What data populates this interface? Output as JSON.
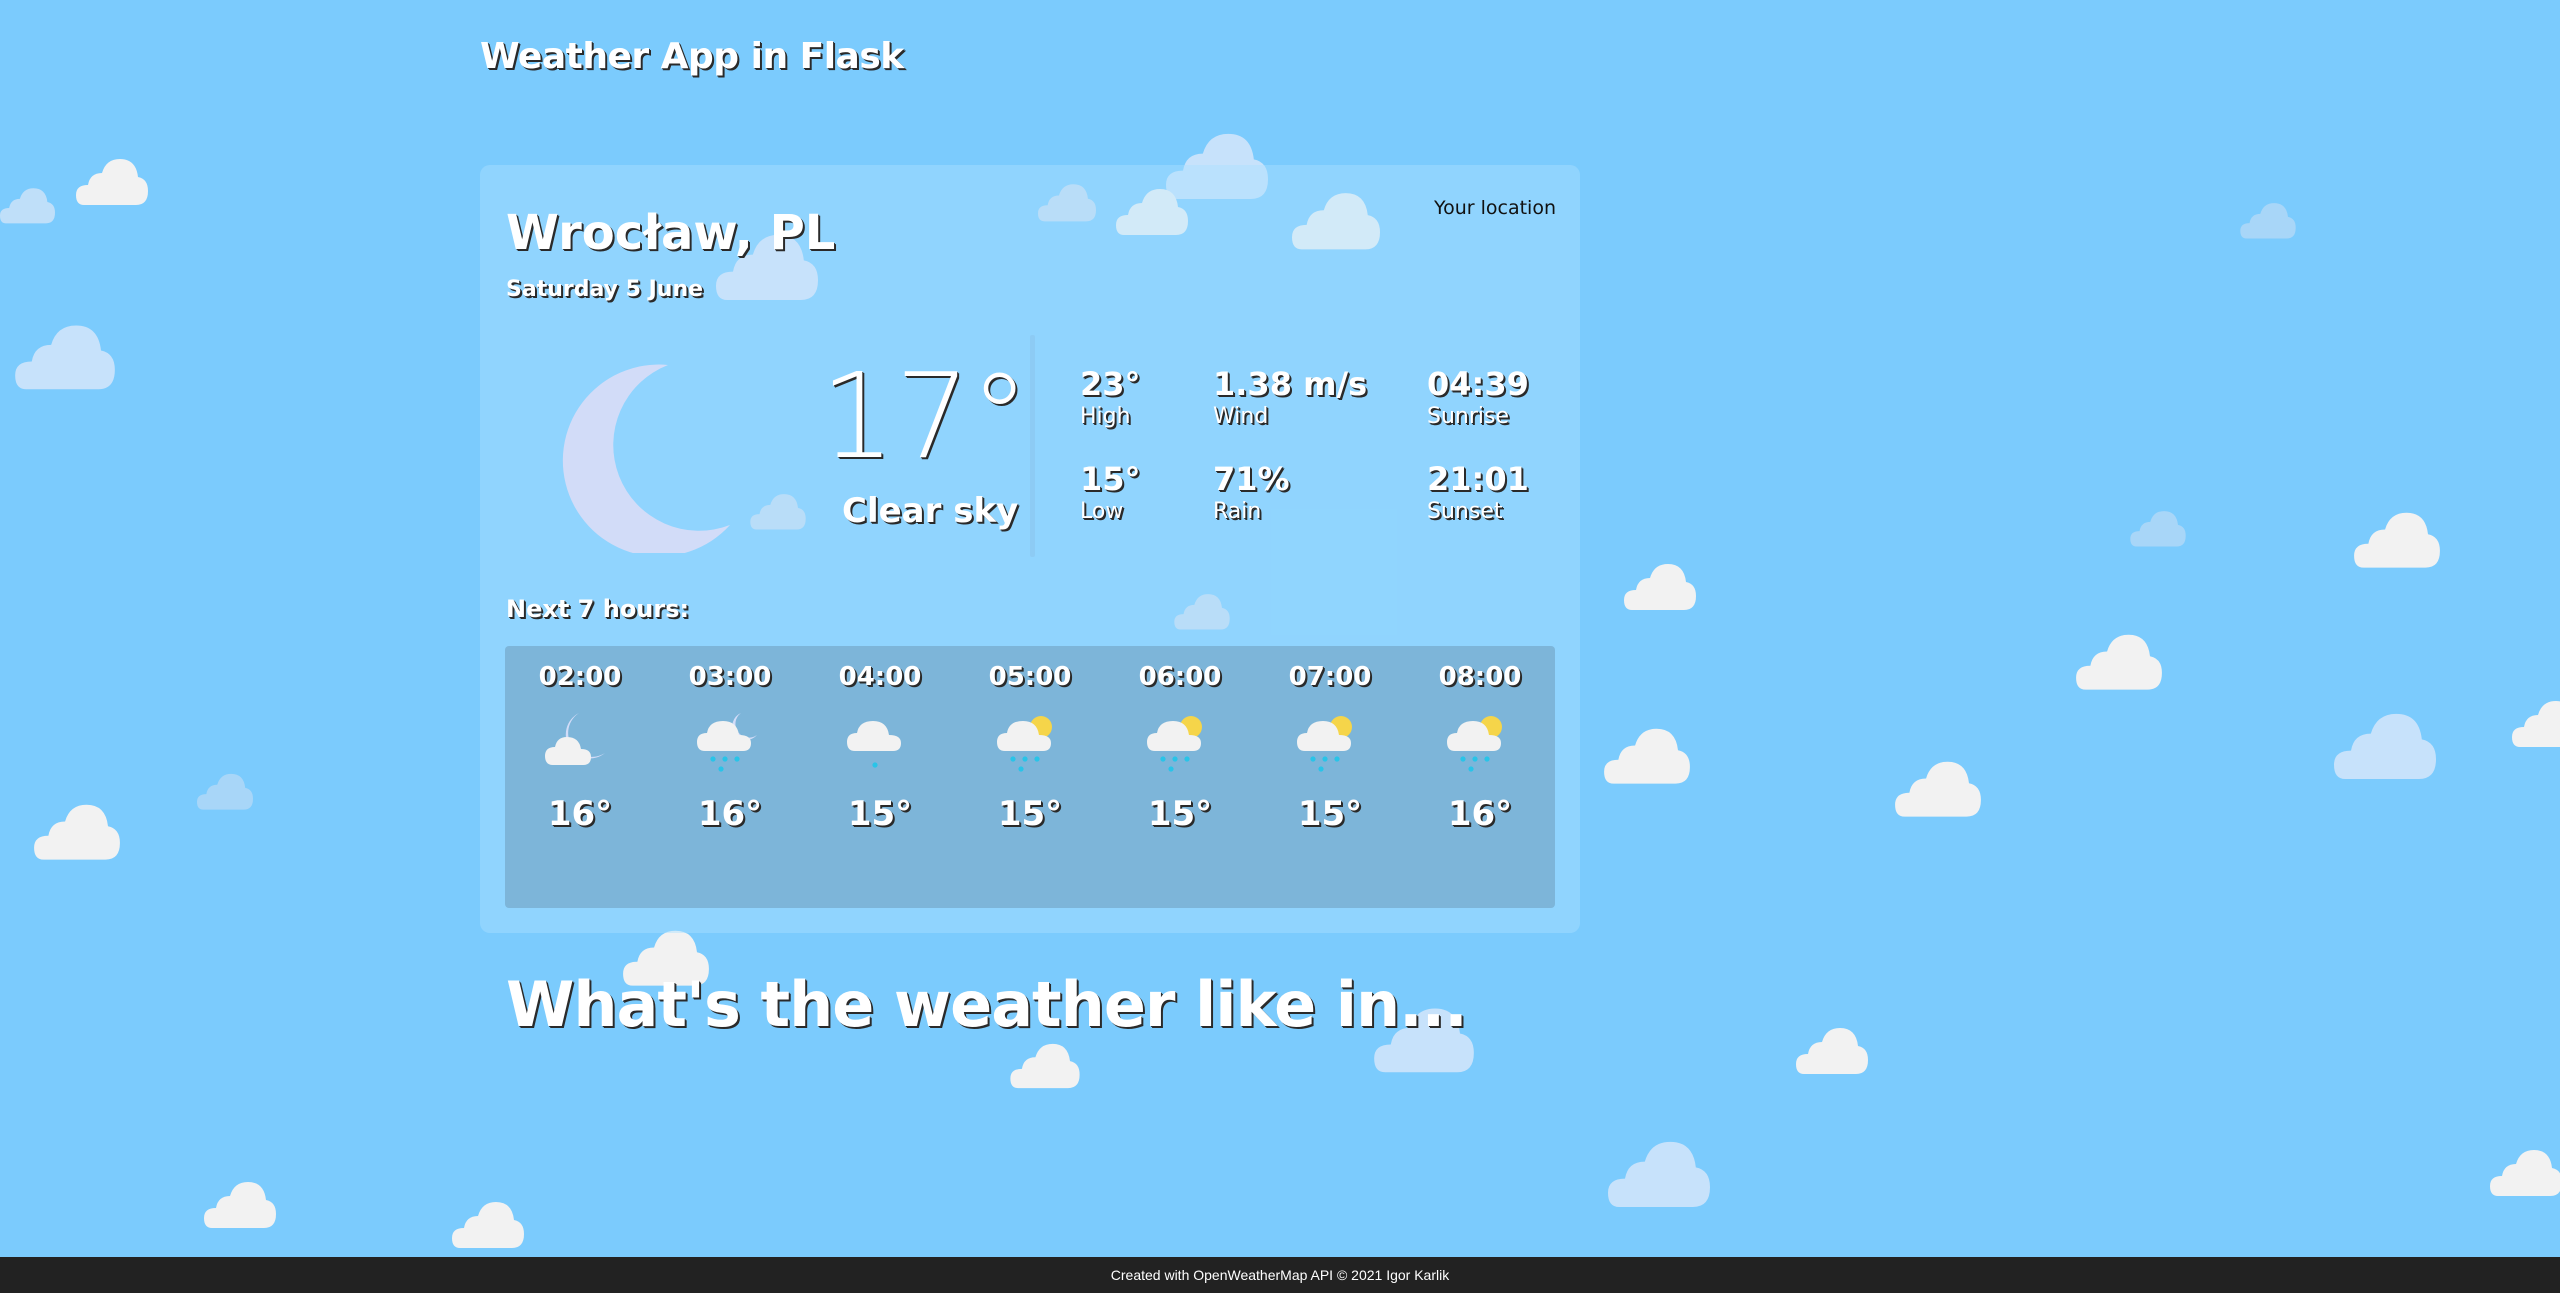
{
  "app_title": "Weather App in Flask",
  "card": {
    "your_location": "Your location",
    "city": "Wrocław, PL",
    "date": "Saturday 5 June",
    "current_icon": "moon-icon",
    "temperature": "17°",
    "condition": "Clear sky",
    "stats": {
      "high": {
        "value": "23°",
        "label": "High"
      },
      "wind": {
        "value": "1.38 m/s",
        "label": "Wind"
      },
      "sunrise": {
        "value": "04:39",
        "label": "Sunrise"
      },
      "low": {
        "value": "15°",
        "label": "Low"
      },
      "rain": {
        "value": "71%",
        "label": "Rain"
      },
      "sunset": {
        "value": "21:01",
        "label": "Sunset"
      }
    }
  },
  "forecast": {
    "label": "Next 7 hours:",
    "hours": [
      {
        "time": "02:00",
        "icon": "cloud-moon-icon",
        "temp": "16°"
      },
      {
        "time": "03:00",
        "icon": "cloud-moon-rain-icon",
        "temp": "16°"
      },
      {
        "time": "04:00",
        "icon": "cloud-light-rain-icon",
        "temp": "15°"
      },
      {
        "time": "05:00",
        "icon": "cloud-sun-rain-icon",
        "temp": "15°"
      },
      {
        "time": "06:00",
        "icon": "cloud-sun-rain-icon",
        "temp": "15°"
      },
      {
        "time": "07:00",
        "icon": "cloud-sun-rain-icon",
        "temp": "15°"
      },
      {
        "time": "08:00",
        "icon": "cloud-sun-rain-icon",
        "temp": "16°"
      }
    ]
  },
  "search": {
    "prompt": "What's the weather like in..."
  },
  "footer": {
    "text": "Created with OpenWeatherMap API © 2021 Igor Karlik"
  },
  "colors": {
    "background": "#7bcbfd",
    "footer": "#222222",
    "cloud": "#f2f2f2",
    "cloud_faint": "#c7e2fb",
    "moon": "#d2dcf8",
    "sun": "#f5d54a",
    "rain": "#29c4e8"
  }
}
